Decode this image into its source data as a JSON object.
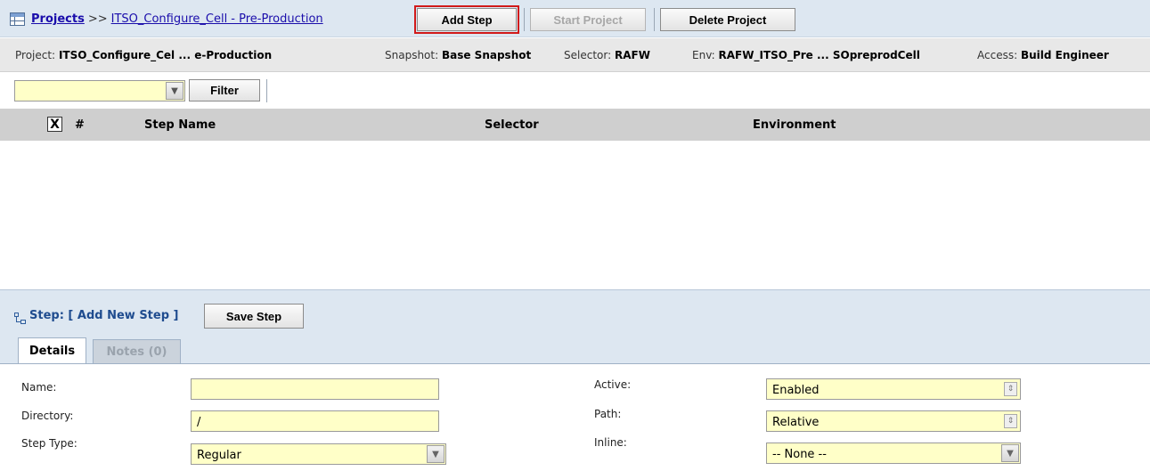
{
  "header": {
    "breadcrumb_root": "Projects",
    "breadcrumb_sep": ">>",
    "breadcrumb_current": "ITSO_Configure_Cell - Pre-Production",
    "buttons": {
      "add_step": "Add Step",
      "start_project": "Start Project",
      "delete_project": "Delete Project"
    }
  },
  "info": {
    "project_label": "Project:",
    "project_value": "ITSO_Configure_Cel ... e-Production",
    "snapshot_label": "Snapshot:",
    "snapshot_value": "Base Snapshot",
    "selector_label": "Selector:",
    "selector_value": "RAFW",
    "env_label": "Env:",
    "env_value": "RAFW_ITSO_Pre ... SOpreprodCell",
    "access_label": "Access:",
    "access_value": "Build Engineer"
  },
  "filter": {
    "value": "",
    "button": "Filter"
  },
  "grid": {
    "select_all_mark": "X",
    "columns": [
      "#",
      "Step Name",
      "Selector",
      "Environment"
    ],
    "rows": []
  },
  "step_panel": {
    "title": "Step: [ Add New Step ]",
    "save_button": "Save Step",
    "tabs": [
      {
        "label": "Details",
        "active": true
      },
      {
        "label": "Notes (0)",
        "active": false
      }
    ],
    "form": {
      "name_label": "Name:",
      "name_value": "",
      "directory_label": "Directory:",
      "directory_value": "/",
      "step_type_label": "Step Type:",
      "step_type_value": "Regular",
      "active_label": "Active:",
      "active_value": "Enabled",
      "path_label": "Path:",
      "path_value": "Relative",
      "inline_label": "Inline:",
      "inline_value": "-- None --"
    }
  },
  "colors": {
    "highlight_outline": "#d11a1a",
    "field_background": "#ffffc8",
    "panel_background": "#dde7f1",
    "link": "#1a0dab"
  }
}
